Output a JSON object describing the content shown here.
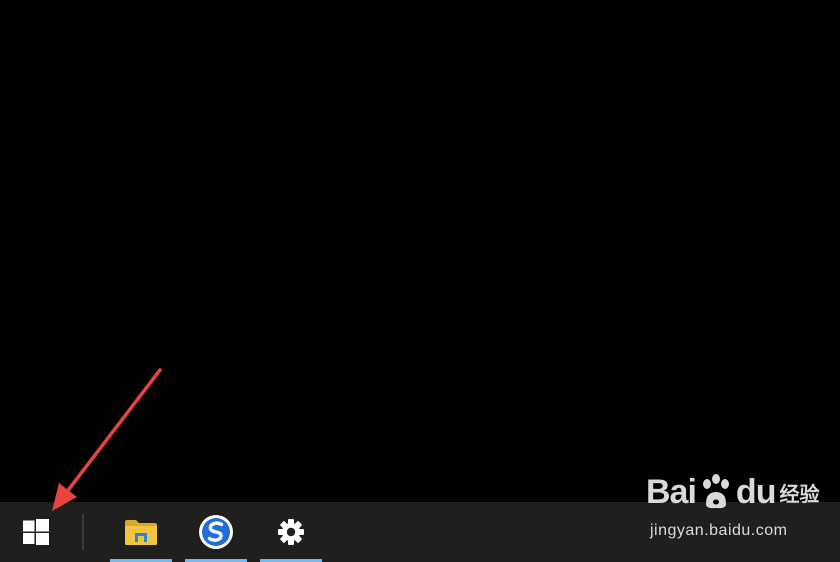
{
  "taskbar": {
    "start": {
      "icon": "windows-logo-icon"
    },
    "pinned": [
      {
        "name": "File Explorer",
        "icon": "folder-icon",
        "running": true
      },
      {
        "name": "Sogou Browser",
        "icon": "sogou-browser-icon",
        "running": true
      },
      {
        "name": "Settings",
        "icon": "gear-icon",
        "running": true
      }
    ]
  },
  "colors": {
    "desktop": "#000000",
    "taskbar": "#1f1f1f",
    "running_indicator": "#76b9ed",
    "annotation_arrow": "#e8443f"
  },
  "watermark": {
    "brand_left": "Bai",
    "brand_right": "du",
    "product": "经验",
    "url": "jingyan.baidu.com"
  }
}
